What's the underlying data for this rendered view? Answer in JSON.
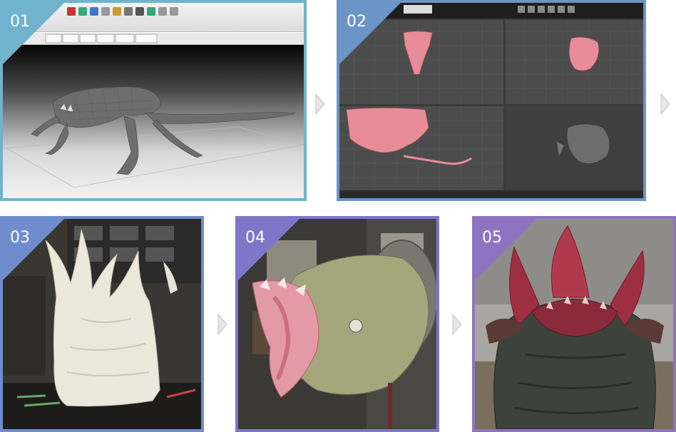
{
  "steps": [
    {
      "number": "01",
      "caption": ""
    },
    {
      "number": "02",
      "caption": ""
    },
    {
      "number": "03",
      "caption": ""
    },
    {
      "number": "04",
      "caption": ""
    },
    {
      "number": "05",
      "caption": ""
    }
  ],
  "colors": {
    "step1_accent": "#6fb3cc",
    "step2_accent": "#6b94c7",
    "step3_accent": "#6f8ccd",
    "step4_accent": "#7d77c9",
    "step5_accent": "#8f73c2",
    "arrow": "#d0d0d0"
  },
  "icons": [
    "chevron-right-icon"
  ]
}
